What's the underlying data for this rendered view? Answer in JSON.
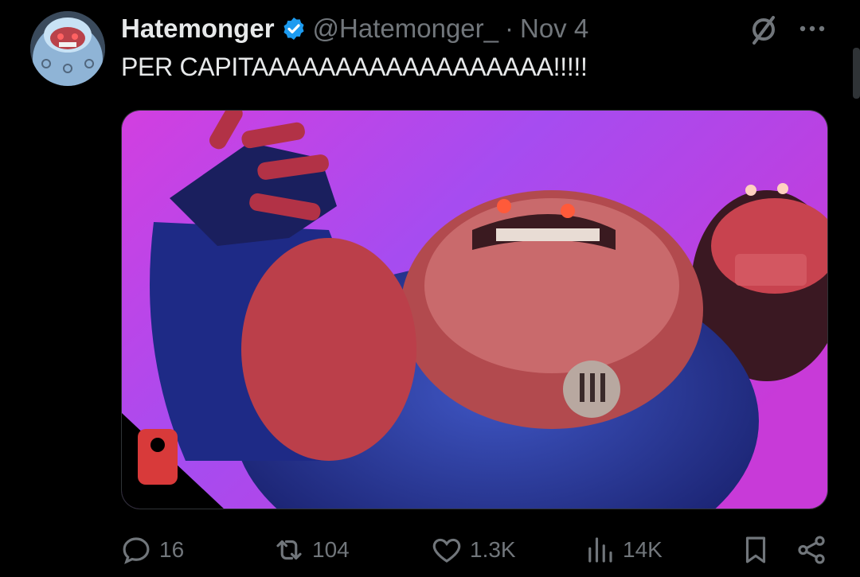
{
  "tweet": {
    "author_name": "Hatemonger",
    "handle": "@Hatemonger_",
    "separator": "·",
    "date": "Nov 4",
    "text": "PER CAPITAAAAAAAAAAAAAAAAAA!!!!!"
  },
  "stats": {
    "replies": "16",
    "reposts": "104",
    "likes": "1.3K",
    "views": "14K"
  },
  "icons": [
    "verified-badge-icon",
    "grok-icon",
    "more-icon",
    "reply-icon",
    "repost-icon",
    "like-icon",
    "views-icon",
    "bookmark-icon",
    "share-icon"
  ],
  "colors": {
    "background": "#000000",
    "text": "#e7e9ea",
    "muted": "#71767b",
    "verified": "#1d9bf0"
  }
}
